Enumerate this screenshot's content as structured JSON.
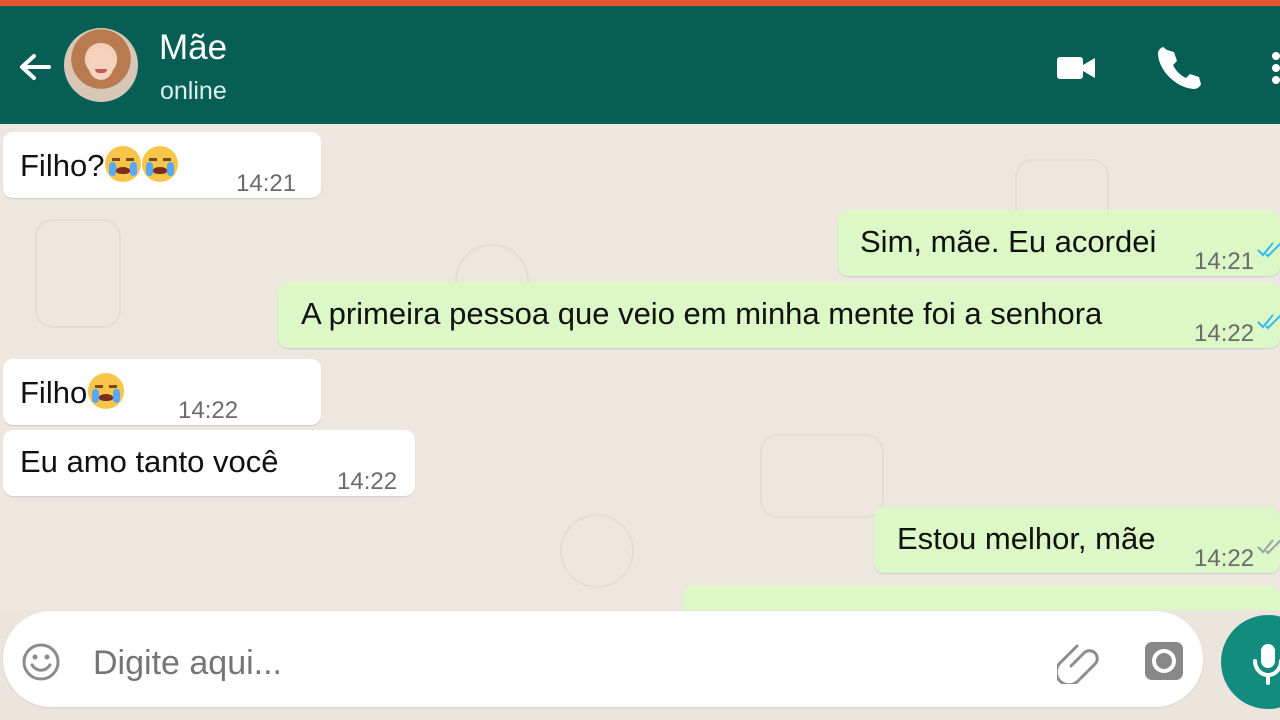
{
  "contact": {
    "name": "Mãe",
    "status": "online"
  },
  "messages": [
    {
      "text": "Filho?",
      "time": "14:21",
      "direction": "incoming",
      "emojis": 2
    },
    {
      "text": "Sim, mãe. Eu acordei",
      "time": "14:21",
      "direction": "outgoing"
    },
    {
      "text": "A primeira pessoa que veio em minha mente foi a senhora",
      "time": "14:22",
      "direction": "outgoing"
    },
    {
      "text": "Filho",
      "time": "14:22",
      "direction": "incoming",
      "emojis": 1
    },
    {
      "text": "Eu amo tanto você",
      "time": "14:22",
      "direction": "incoming"
    },
    {
      "text": "Estou melhor, mãe",
      "time": "14:22",
      "direction": "outgoing"
    }
  ],
  "composer": {
    "placeholder": "Digite aqui..."
  },
  "icons": [
    "back-arrow-icon",
    "video-call-icon",
    "phone-icon",
    "more-vert-icon",
    "emoji-icon",
    "attach-icon",
    "camera-icon",
    "microphone-icon",
    "read-receipt-icon"
  ],
  "colors": {
    "header": "#075e54",
    "outgoing_bubble": "#dcf8c6",
    "incoming_bubble": "#ffffff",
    "accent": "#128c7e"
  }
}
